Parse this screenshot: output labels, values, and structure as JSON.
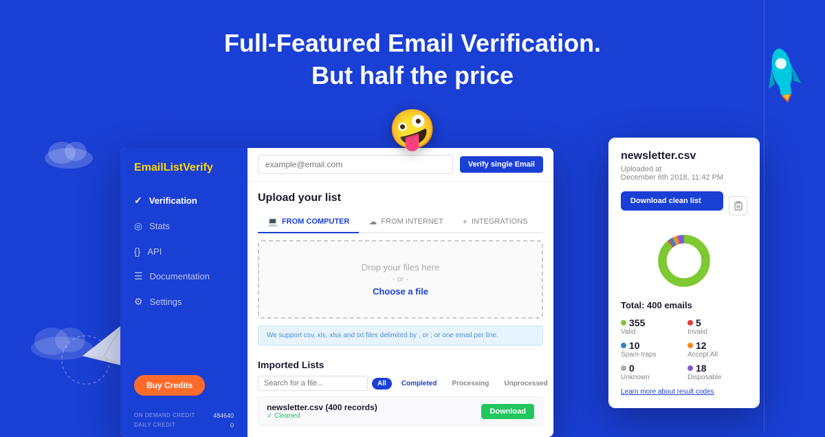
{
  "page": {
    "background_color": "#1a3fd4",
    "heading_line1": "Full-Featured Email Verification.",
    "heading_line2": "But half the price"
  },
  "sidebar": {
    "logo_main": "EmailList",
    "logo_accent": "Verify",
    "nav_items": [
      {
        "label": "Verification",
        "icon": "✓",
        "active": true
      },
      {
        "label": "Stats",
        "icon": "◎",
        "active": false
      },
      {
        "label": "API",
        "icon": "{}",
        "active": false
      },
      {
        "label": "Documentation",
        "icon": "☰",
        "active": false
      },
      {
        "label": "Settings",
        "icon": "⚙",
        "active": false
      }
    ],
    "buy_credits_label": "Buy Credits",
    "credit_rows": [
      {
        "label": "ON DEMAND CREDIT",
        "value": "484640"
      },
      {
        "label": "DAILY CREDIT",
        "value": "0"
      }
    ]
  },
  "topbar": {
    "email_placeholder": "example@email.com",
    "verify_button": "Verify single Email"
  },
  "upload": {
    "title": "Upload your list",
    "tabs": [
      {
        "label": "FROM COMPUTER",
        "icon": "💻",
        "active": true
      },
      {
        "label": "FROM INTERNET",
        "icon": "☁",
        "active": false
      },
      {
        "label": "INTEGRATIONS",
        "icon": "+",
        "active": false
      }
    ],
    "drop_text": "Drop your files here",
    "or_text": "- or -",
    "choose_file": "Choose a file",
    "support_text": "We support csv, xls, xlsx and txt files delimited by ,  or  ;  or one email per line."
  },
  "imported_lists": {
    "title": "Imported Lists",
    "search_placeholder": "Search for a file...",
    "filters": [
      "All",
      "Completed",
      "Processing",
      "Unprocessed"
    ],
    "active_filter": "All",
    "items": [
      {
        "name": "newsletter.csv (400 records)",
        "badge": "Cleaned",
        "download_label": "Download"
      }
    ]
  },
  "card": {
    "title": "newsletter.csv",
    "subtitle": "Uploaded at\nDecember 6th 2018, 11:42 PM",
    "download_btn": "Download clean list",
    "total_label": "Total: 400 emails",
    "stats": [
      {
        "num": "355",
        "label": "Valid",
        "dot": "green"
      },
      {
        "num": "5",
        "label": "Invalid",
        "dot": "red"
      },
      {
        "num": "10",
        "label": "Spam-traps",
        "dot": "blue"
      },
      {
        "num": "12",
        "label": "Accept All",
        "dot": "orange"
      },
      {
        "num": "0",
        "label": "Unknown",
        "dot": "gray"
      },
      {
        "num": "18",
        "label": "Disposable",
        "dot": "purple"
      }
    ],
    "learn_more": "Learn more about result codes",
    "donut": {
      "segments": [
        {
          "color": "#7ec832",
          "percent": 88.75
        },
        {
          "color": "#e53e3e",
          "percent": 1.25
        },
        {
          "color": "#3182ce",
          "percent": 2.5
        },
        {
          "color": "#f6891f",
          "percent": 3
        },
        {
          "color": "#aaa",
          "percent": 0
        },
        {
          "color": "#805ad5",
          "percent": 4.5
        }
      ]
    }
  },
  "decorations": {
    "emoji": "🤪",
    "rocket": "🚀",
    "plane": "✈"
  }
}
